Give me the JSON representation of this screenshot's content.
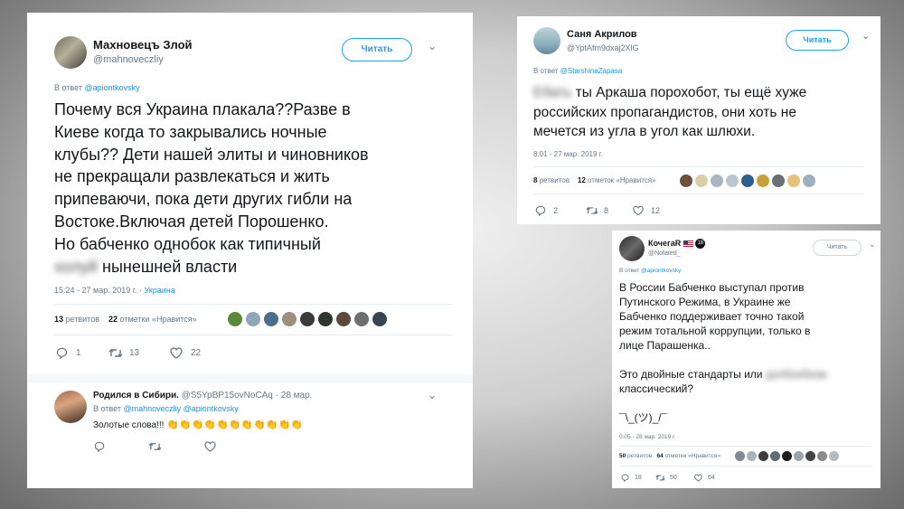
{
  "tweet1": {
    "author": "Махновецъ Злой",
    "handle": "@mahnoveczliy",
    "follow": "Читать",
    "reply_prefix": "В ответ",
    "reply_to": "@apiontkovsky",
    "text_lines": [
      "Почему вся Украина плакала??Разве в",
      "Киеве когда то закрывались ночные",
      "клубы?? Дети нашей элиты и чиновников",
      "не прекращали развлекаться и жить",
      "припеваючи, пока дети других гибли на",
      "Востоке.Включая детей Порошенко.",
      "Но бабченко однобок как типичный"
    ],
    "last_blur": "холуй",
    "last_rest": "нынешней власти",
    "timestamp": "15:24 - 27 мар. 2019 г.",
    "location": "Украина",
    "retweets_num": "13",
    "retweets_label": "ретвитов",
    "likes_num": "22",
    "likes_label": "отметки «Нравится»",
    "replies": "1",
    "rt": "13",
    "likes": "22"
  },
  "reply1": {
    "author": "Родился в Сибири.",
    "handle": "@S5YpBP15ovNoCAq",
    "date": "28 мар.",
    "reply_prefix": "В ответ",
    "reply_to": "@mahnoveczliy @apiontkovsky",
    "text": "Золотые слова!!!",
    "claps": "👏👏👏👏👏👏👏👏👏👏👏"
  },
  "tweet2": {
    "author": "Саня Акрилов",
    "handle": "@YptAfm9dxaj2XlG",
    "follow": "Читать",
    "reply_prefix": "В ответ",
    "reply_to": "@StarshinaZapasa",
    "blur_word": "Ебать",
    "text_first": "ты Аркаша порохобот, ты ещё хуже",
    "text_lines": [
      "российских пропагандистов, они хоть не",
      "мечется из угла в угол как шлюхи."
    ],
    "timestamp": "8:01 - 27 мар. 2019 г.",
    "retweets_num": "8",
    "retweets_label": "ретвитов",
    "likes_num": "12",
    "likes_label": "отметок «Нравится»",
    "replies": "2",
    "rt": "8",
    "likes": "12"
  },
  "tweet3": {
    "author": "КочегаR",
    "badge": "18",
    "handle": "@Nofated_",
    "follow": "Читать",
    "reply_prefix": "В ответ",
    "reply_to": "@apiontkovsky",
    "text_lines": [
      "В России Бабченко выступал против",
      "Путинского Режима, в Украине же",
      "Бабченко поддерживает точно такой",
      "режим тотальной коррупции, только в",
      "лице Парашенка.."
    ],
    "text2_start": "Это двойные стандарты или",
    "text2_blur": "долбоебизм",
    "text2_end": "классический?",
    "shrug": "¯\\_(ツ)_/¯",
    "timestamp": "0:05 - 28 мар. 2019 г.",
    "retweets_num": "50",
    "retweets_label": "ретвитов",
    "likes_num": "64",
    "likes_label": "отметки «Нравится»",
    "replies": "18",
    "rt": "50",
    "likes": "64"
  },
  "colors": {
    "link": "#1b95e0",
    "muted": "#657786",
    "follow_border": "#1da1f2"
  }
}
